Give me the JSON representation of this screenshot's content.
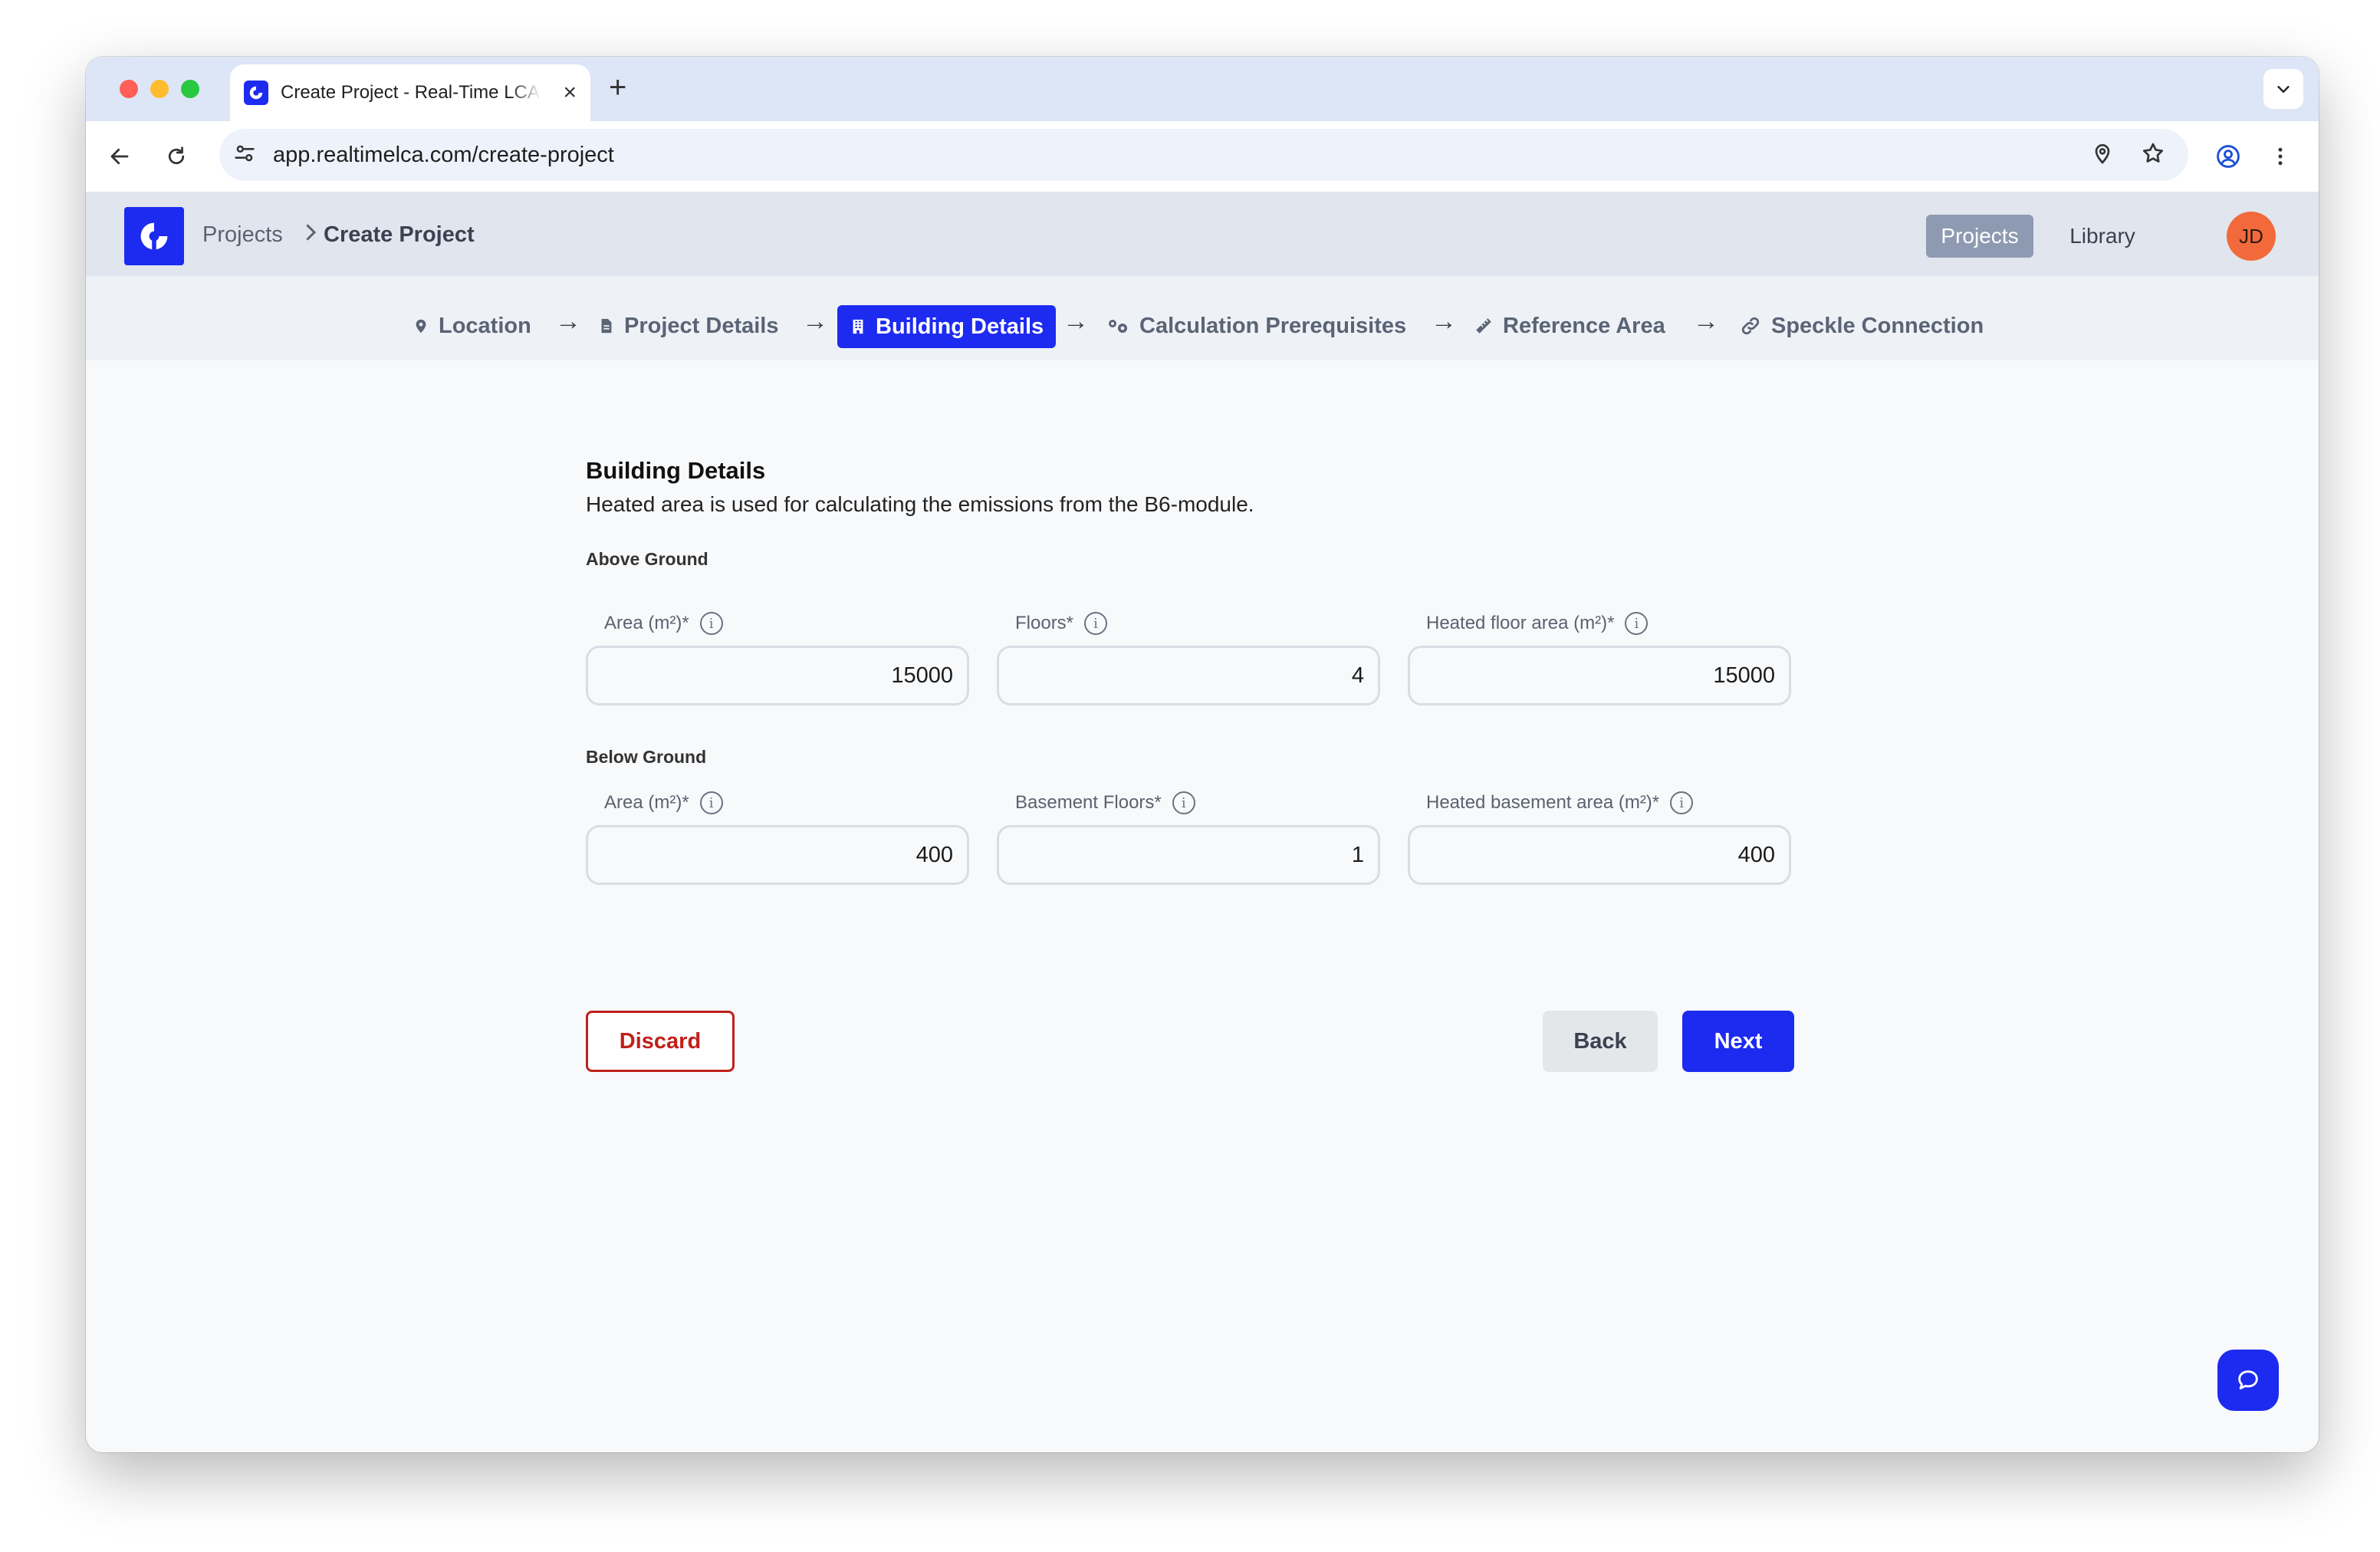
{
  "browser": {
    "tab_title": "Create Project - Real-Time LCA",
    "url": "app.realtimelca.com/create-project"
  },
  "app": {
    "breadcrumb": [
      "Projects",
      "Create Project"
    ],
    "nav": [
      "Projects",
      "Library"
    ],
    "avatar_initials": "JD",
    "brand_color": "#1d2bf0"
  },
  "stepper": {
    "steps": [
      {
        "label": "Location",
        "icon": "map-pin-icon"
      },
      {
        "label": "Project Details",
        "icon": "document-icon"
      },
      {
        "label": "Building Details",
        "icon": "building-icon",
        "active": true
      },
      {
        "label": "Calculation Prerequisites",
        "icon": "gears-icon"
      },
      {
        "label": "Reference Area",
        "icon": "ruler-icon"
      },
      {
        "label": "Speckle Connection",
        "icon": "link-icon"
      }
    ]
  },
  "form": {
    "title": "Building Details",
    "subtitle": "Heated area is used for calculating the emissions from the B6-module.",
    "above_ground": {
      "label": "Above Ground",
      "area_label": "Area (m²)*",
      "area_value": "15000",
      "floors_label": "Floors*",
      "floors_value": "4",
      "heated_label": "Heated floor area (m²)*",
      "heated_value": "15000"
    },
    "below_ground": {
      "label": "Below Ground",
      "area_label": "Area (m²)*",
      "area_value": "400",
      "floors_label": "Basement Floors*",
      "floors_value": "1",
      "heated_label": "Heated basement area (m²)*",
      "heated_value": "400"
    },
    "buttons": {
      "discard": "Discard",
      "back": "Back",
      "next": "Next"
    }
  }
}
